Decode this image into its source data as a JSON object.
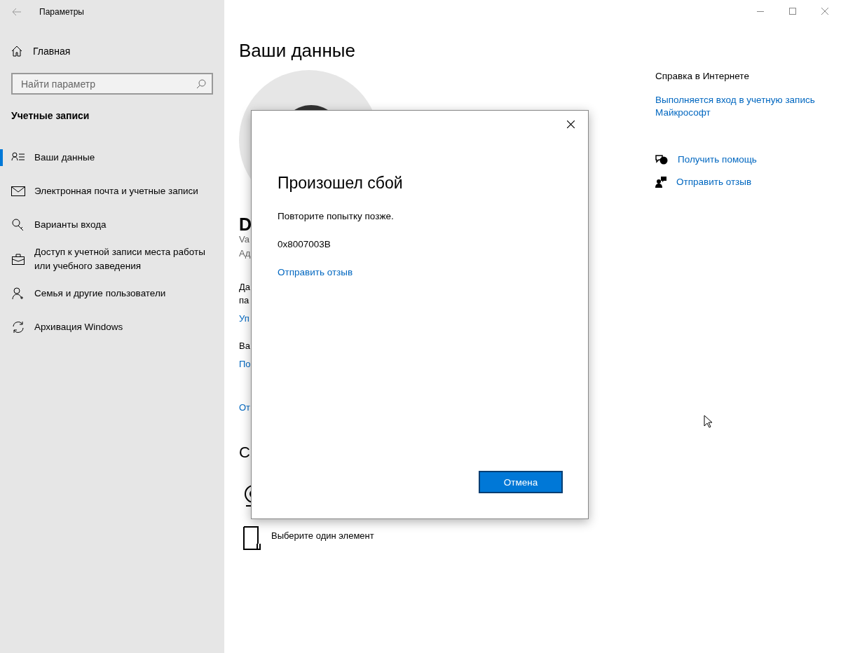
{
  "window": {
    "title": "Параметры"
  },
  "sidebar": {
    "home": "Главная",
    "search": {
      "placeholder": "Найти параметр"
    },
    "section": "Учетные записи",
    "items": [
      {
        "label": "Ваши данные",
        "selected": true
      },
      {
        "label": "Электронная почта и учетные записи",
        "selected": false
      },
      {
        "label": "Варианты входа",
        "selected": false
      },
      {
        "label": "Доступ к учетной записи места работы или учебного заведения",
        "selected": false
      },
      {
        "label": "Семья и другие пользователи",
        "selected": false
      },
      {
        "label": "Архивация Windows",
        "selected": false
      }
    ]
  },
  "main": {
    "title": "Ваши данные",
    "fragments": [
      {
        "kind": "name",
        "text": "D"
      },
      {
        "kind": "muted",
        "text": "Va"
      },
      {
        "kind": "muted",
        "text": "Ад"
      },
      {
        "kind": "text",
        "text": "Да"
      },
      {
        "kind": "text",
        "text": "па"
      },
      {
        "kind": "link",
        "text": "Уп"
      },
      {
        "kind": "text",
        "text": "Ва"
      },
      {
        "kind": "link",
        "text": "По"
      },
      {
        "kind": "link",
        "text": "От"
      },
      {
        "kind": "heading",
        "text": "С"
      }
    ],
    "choose_item": "Выберите один элемент"
  },
  "help": {
    "title": "Справка в Интернете",
    "link": "Выполняется вход в учетную запись Майкрософт",
    "get_help": "Получить помощь",
    "feedback": "Отправить отзыв"
  },
  "dialog": {
    "title": "Произошел сбой",
    "message": "Повторите попытку позже.",
    "code": "0x8007003B",
    "link": "Отправить отзыв",
    "button": "Отмена"
  }
}
